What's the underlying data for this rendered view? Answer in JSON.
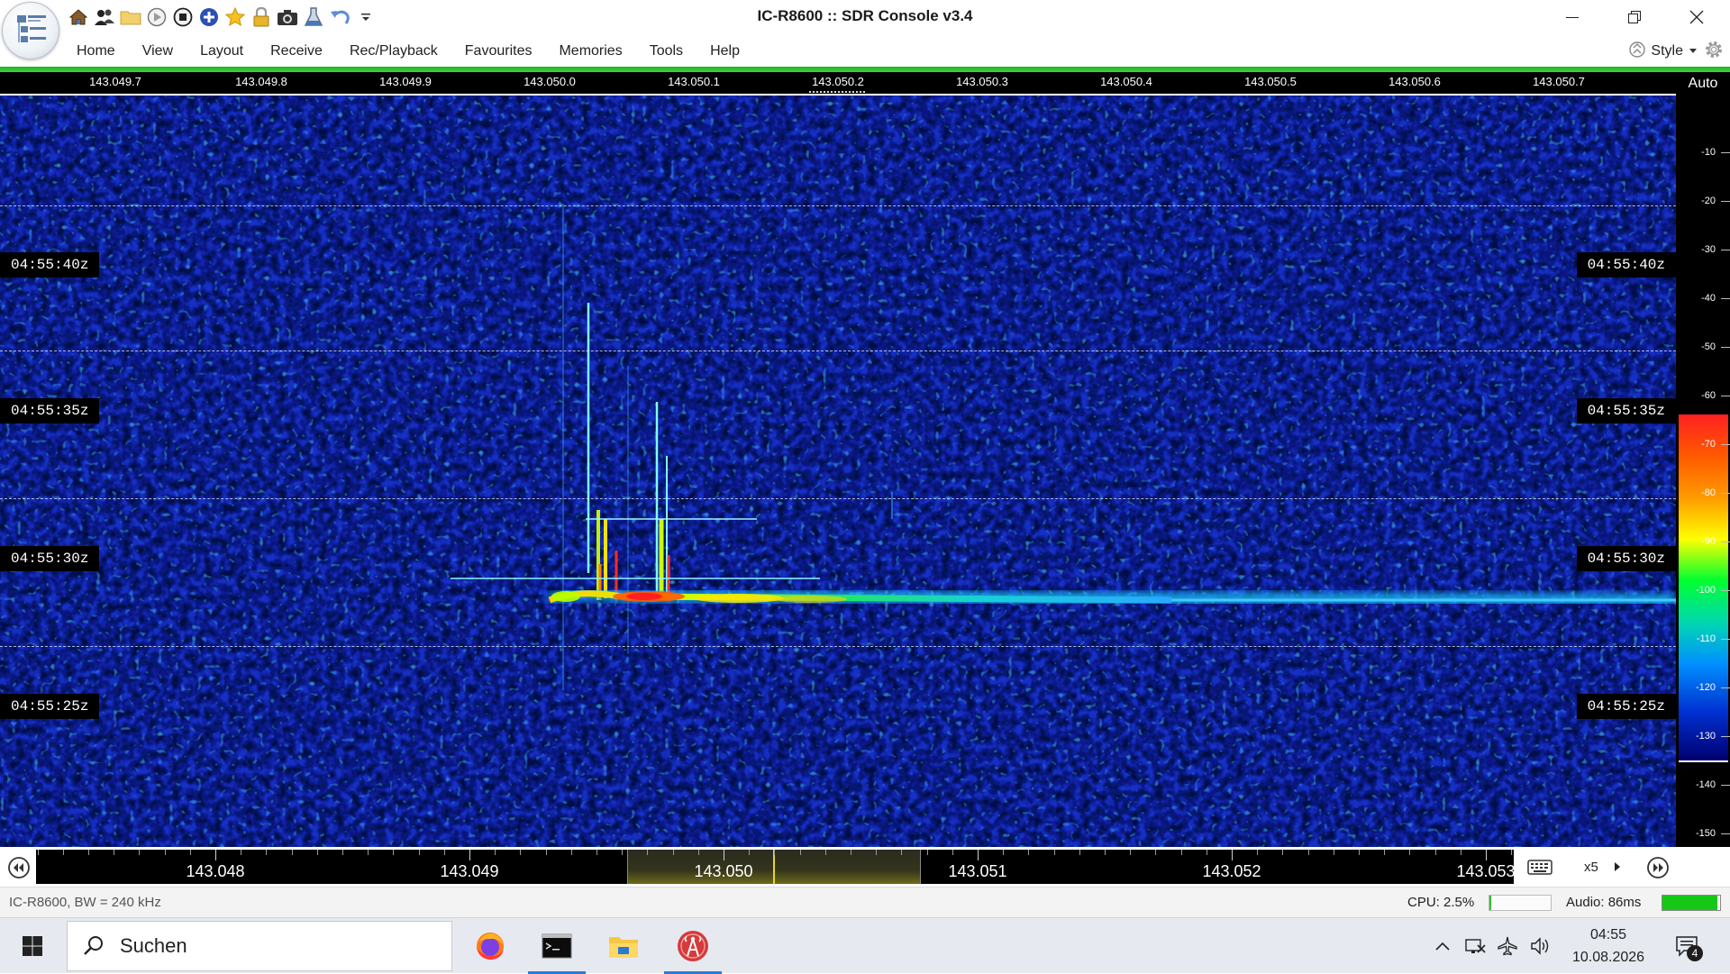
{
  "window": {
    "title": "IC-R8600 :: SDR Console v3.4",
    "buttons": [
      "minimize-icon",
      "restore-icon",
      "close-icon"
    ]
  },
  "quick_access": [
    "home-icon",
    "users-icon",
    "folder-icon",
    "play-icon",
    "stop-icon",
    "add-circle-icon",
    "star-icon",
    "lock-icon",
    "camera-icon",
    "flask-icon",
    "undo-icon",
    "customize-dropdown-icon"
  ],
  "menu": {
    "items": [
      "Home",
      "View",
      "Layout",
      "Receive",
      "Rec/Playback",
      "Favourites",
      "Memories",
      "Tools",
      "Help"
    ],
    "style_label": "Style"
  },
  "top_ruler": {
    "ticks": [
      "143.049.7",
      "143.049.8",
      "143.049.9",
      "143.050.0",
      "143.050.1",
      "143.050.2",
      "143.050.3",
      "143.050.4",
      "143.050.5",
      "143.050.6",
      "143.050.7"
    ],
    "auto_label": "Auto"
  },
  "waterfall": {
    "time_labels": [
      "04:55:40z",
      "04:55:35z",
      "04:55:30z",
      "04:55:25z"
    ]
  },
  "db_scale": {
    "labels": [
      "-10",
      "-20",
      "-30",
      "-40",
      "-50",
      "-60",
      "-70",
      "-80",
      "-90",
      "-100",
      "-110",
      "-120",
      "-130",
      "-140",
      "-150"
    ],
    "colorbar_colors": [
      "#ff2020",
      "#ff9a00",
      "#ffff00",
      "#00ff30",
      "#00d8b0",
      "#0090ff",
      "#0030d0",
      "#000070"
    ]
  },
  "bottom_ruler": {
    "labels": [
      "143.048",
      "143.049",
      "143.050",
      "143.051",
      "143.052",
      "143.053"
    ],
    "zoom": "x5"
  },
  "status": {
    "left": "IC-R8600, BW = 240 kHz",
    "cpu": "CPU: 2.5%",
    "cpu_fraction": 0.025,
    "audio": "Audio: 86ms",
    "audio_level": 0.95
  },
  "taskbar": {
    "search_placeholder": "Suchen",
    "apps": [
      "firefox-icon",
      "terminal-icon",
      "file-explorer-icon",
      "sdr-console-icon"
    ],
    "tray": [
      "chevron-up-icon",
      "network-icon",
      "airplane-mode-icon",
      "volume-icon"
    ],
    "time": "04:55",
    "date": "10.08.2026",
    "notification_count": "4"
  },
  "colors": {
    "accent_green": "#1bb51b",
    "waterfall_background": "#1428b8",
    "taskbar_highlight": "#2a7bd6"
  }
}
